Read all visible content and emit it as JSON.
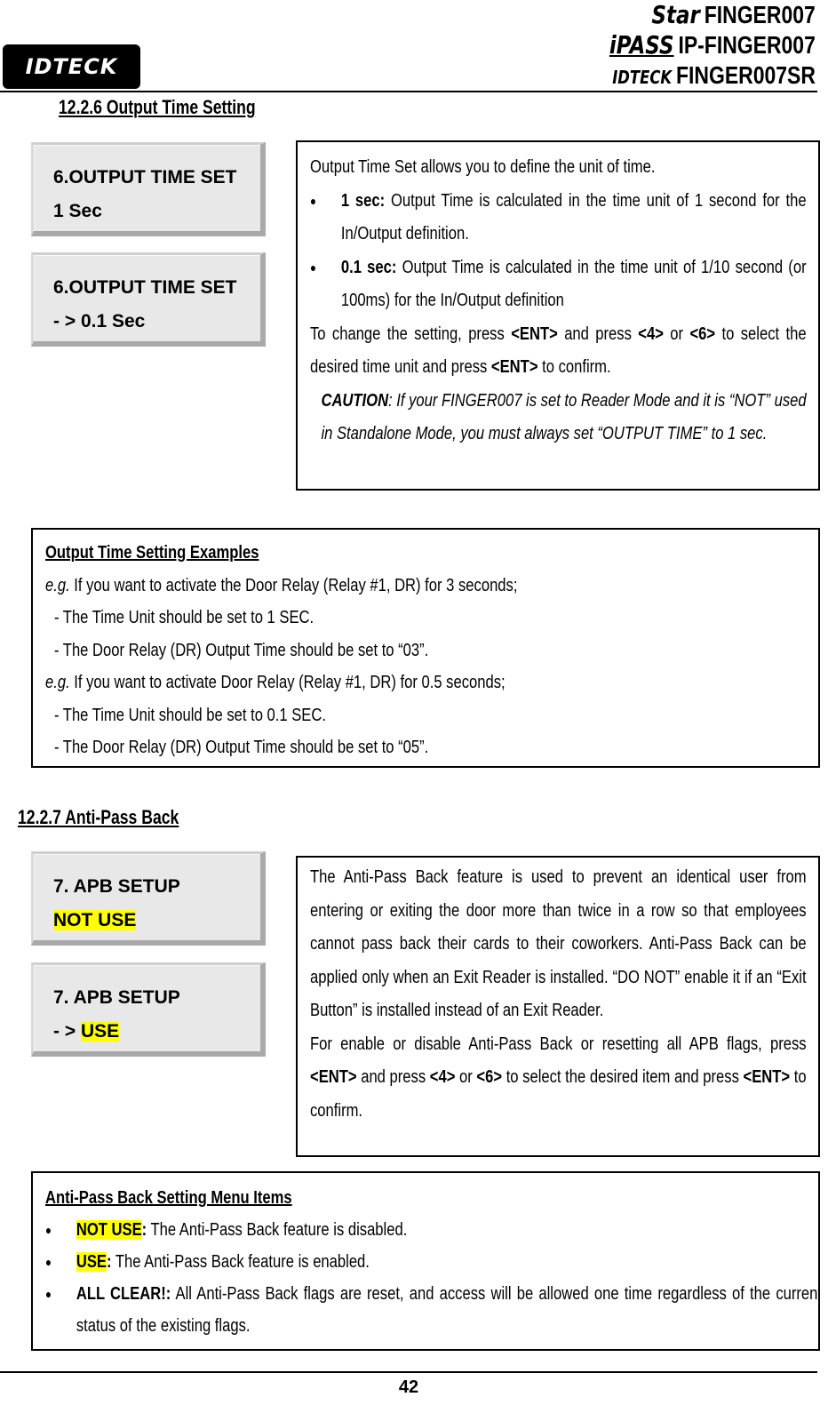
{
  "header": {
    "logo_left": "IDTECK",
    "products": [
      {
        "mark": "Star",
        "model": "FINGER007"
      },
      {
        "mark": "iPASS",
        "model": "IP-FINGER007"
      },
      {
        "mark": "IDTECK",
        "model": "FINGER007SR"
      }
    ]
  },
  "section_output": {
    "heading": "12.2.6 Output Time Setting",
    "lcd_screens": [
      {
        "line1": "6.OUTPUT TIME SET",
        "line2_prefix": "",
        "line2": "1 Sec"
      },
      {
        "line1": "6.OUTPUT TIME SET",
        "line2_prefix": "- > ",
        "line2": "0.1 Sec"
      }
    ],
    "intro": "Output Time Set allows you to define the unit of time.",
    "bullets": [
      {
        "term": "1 sec:",
        "text": " Output Time is calculated in the time unit of 1 second for the In/Output definition."
      },
      {
        "term": "0.1 sec:",
        "text": " Output Time is calculated in the time unit of 1/10 second (or 100ms) for the In/Output definition"
      }
    ],
    "instruction": {
      "p1": "To change the setting, press ",
      "k1": "<ENT>",
      "p2": " and press ",
      "k2": "<4>",
      "p3": " or ",
      "k3": "<6>",
      "p4": " to select the desired time unit and press ",
      "k4": "<ENT>",
      "p5": " to confirm."
    },
    "caution_label": "CAUTION",
    "caution_text": ": If your FINGER007 is set to Reader Mode and it is “NOT” used in Standalone Mode, you must always set “OUTPUT TIME” to 1 sec."
  },
  "examples": {
    "title": "Output Time Setting Examples",
    "items": [
      {
        "eg": "e.g.",
        "text": " If you want to activate the Door Relay (Relay #1, DR) for 3 seconds;",
        "steps": [
          "- The Time Unit should be set to 1 SEC.",
          "- The Door Relay (DR) Output Time should be set to “03”."
        ]
      },
      {
        "eg": "e.g.",
        "text": " If you want to activate Door Relay (Relay #1, DR) for 0.5 seconds;",
        "steps": [
          "- The Time Unit should be set to 0.1 SEC.",
          "- The Door Relay (DR) Output Time should be set to “05”."
        ]
      }
    ]
  },
  "section_apb": {
    "heading": "12.2.7 Anti-Pass Back",
    "lcd_screens": [
      {
        "line1": "7. APB SETUP",
        "line2_prefix": "",
        "line2": "NOT USE"
      },
      {
        "line1": "7. APB SETUP",
        "line2_prefix": "- > ",
        "line2": "USE"
      }
    ],
    "description": "The Anti-Pass Back feature is used to prevent an identical user from entering or exiting the door more than twice in a row so that employees cannot pass back their cards to their coworkers. Anti-Pass Back can be applied only when an Exit Reader is installed. “DO NOT” enable it if an “Exit Button” is installed instead of an Exit Reader.",
    "instruction": {
      "p1": "For enable or disable Anti-Pass Back or resetting all APB flags, press ",
      "k1": "<ENT>",
      "p2": " and press ",
      "k2": "<4>",
      "p3": " or ",
      "k3": "<6>",
      "p4": " to select the desired item and press ",
      "k4": "<ENT>",
      "p5": " to confirm."
    }
  },
  "menu_items": {
    "title": "Anti-Pass Back Setting Menu Items",
    "items": [
      {
        "term": "NOT USE",
        "colon": ":",
        "text": " The Anti-Pass Back feature is disabled."
      },
      {
        "term": "USE",
        "colon": ":",
        "text": " The Anti-Pass Back feature is enabled."
      },
      {
        "term": "ALL CLEAR!:",
        "colon": "",
        "text": " All Anti-Pass Back flags are reset, and access will be allowed one time regardless of the current status of the existing flags."
      }
    ]
  },
  "footer": {
    "page_number": "42"
  },
  "colors": {
    "highlight": "#ffff00",
    "lcd_bg": "#e8e8e8"
  }
}
